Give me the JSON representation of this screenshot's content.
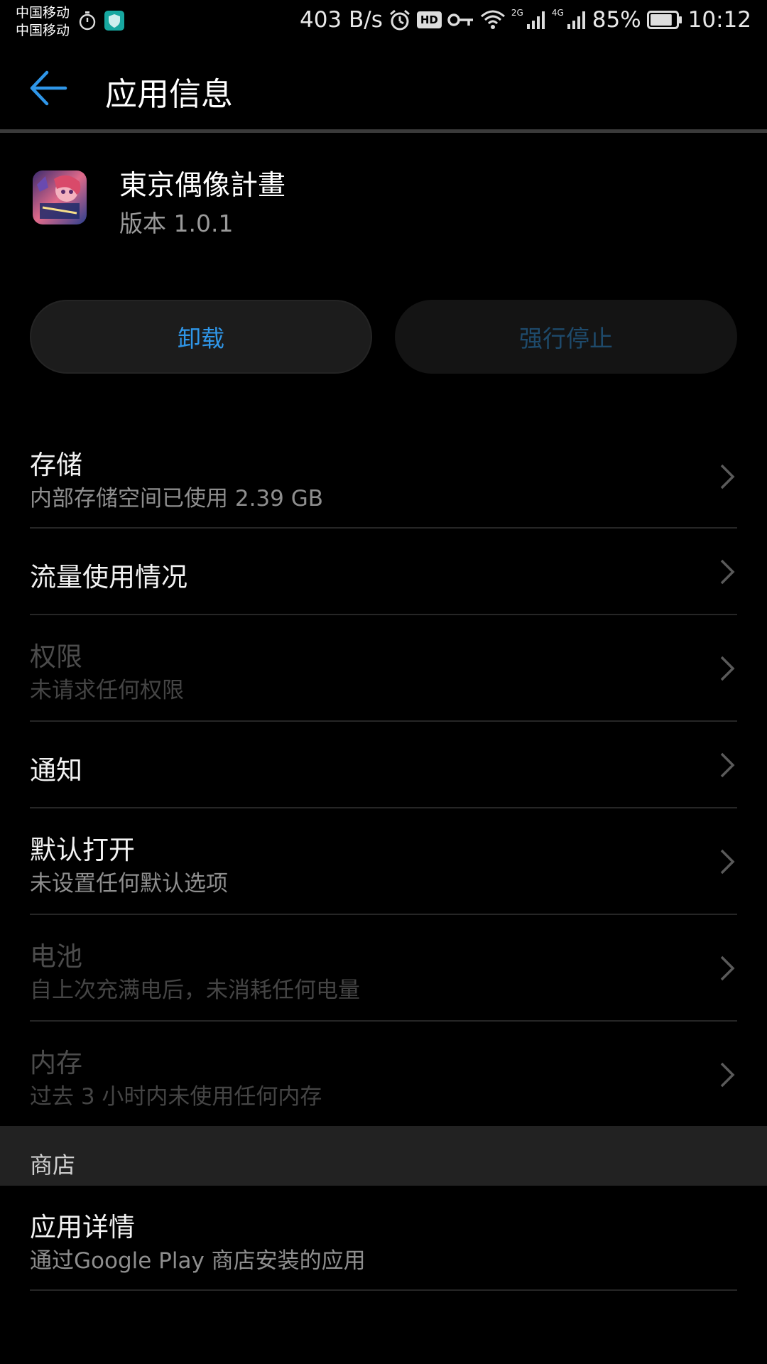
{
  "status_bar": {
    "carrier_1": "中国移动",
    "carrier_2": "中国移动",
    "net_speed": "403 B/s",
    "hd": "HD",
    "sim1_net": "2G",
    "sim2_net": "4G",
    "battery": "85%",
    "battery_level": 0.85,
    "time": "10:12"
  },
  "header": {
    "title": "应用信息"
  },
  "app": {
    "name": "東京偶像計畫",
    "version": "版本 1.0.1"
  },
  "actions": {
    "uninstall": "卸载",
    "force_stop": "强行停止"
  },
  "rows": [
    {
      "title": "存储",
      "subtitle": "内部存储空间已使用 2.39 GB"
    },
    {
      "title": "流量使用情况"
    },
    {
      "title": "权限",
      "subtitle": "未请求任何权限"
    },
    {
      "title": "通知"
    },
    {
      "title": "默认打开",
      "subtitle": "未设置任何默认选项"
    },
    {
      "title": "电池",
      "subtitle": "自上次充满电后，未消耗任何电量"
    },
    {
      "title": "内存",
      "subtitle": "过去 3 小时内未使用任何内存"
    }
  ],
  "store_section": {
    "header": "商店",
    "item_title": "应用详情",
    "item_subtitle": "通过Google Play 商店安装的应用"
  },
  "colors": {
    "accent": "#2f96e8",
    "background": "#000000"
  }
}
